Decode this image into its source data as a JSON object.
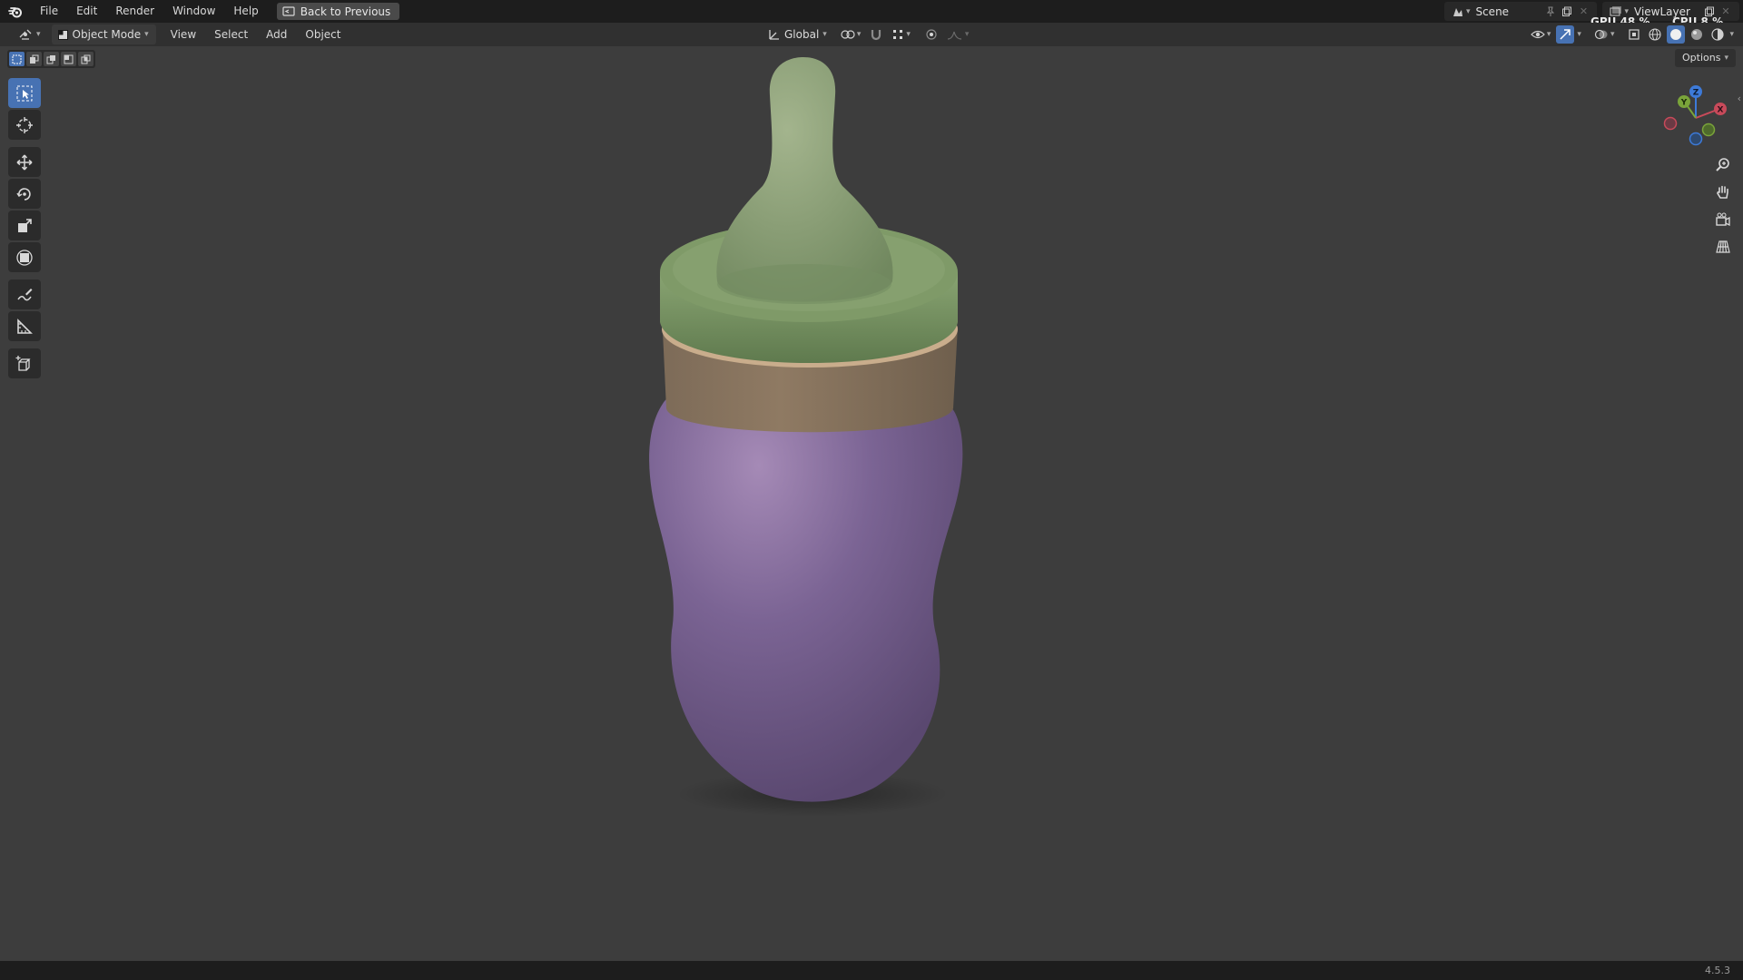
{
  "topbar": {
    "menus": [
      "File",
      "Edit",
      "Render",
      "Window",
      "Help"
    ],
    "back_button": "Back to Previous",
    "scene_name": "Scene",
    "view_layer_name": "ViewLayer",
    "gpu_label": "GPU",
    "gpu_value": "48 %",
    "cpu_label": "CPU",
    "cpu_value": "8 %"
  },
  "header": {
    "mode": "Object Mode",
    "menus": [
      "View",
      "Select",
      "Add",
      "Object"
    ],
    "transform_orientation": "Global"
  },
  "viewport": {
    "options_label": "Options",
    "gizmo_axes": {
      "x": "X",
      "y": "Y",
      "z": "Z"
    },
    "object": {
      "type": "baby-bottle",
      "colors": {
        "body": "#7b6494",
        "ring": "#8b7660",
        "collar": "#6e8a5c",
        "nipple": "#8fa47a"
      }
    }
  },
  "toolbar": {
    "tools": [
      "select-box",
      "cursor",
      "move",
      "rotate",
      "scale",
      "transform",
      "annotate",
      "measure",
      "add-cube"
    ],
    "active_tool": "select-box"
  },
  "status": {
    "version": "4.5.3"
  },
  "colors": {
    "accent": "#4772b3",
    "viewport_bg": "#3d3d3d",
    "bar_bg": "#1d1d1d",
    "header_bg": "#303030"
  }
}
